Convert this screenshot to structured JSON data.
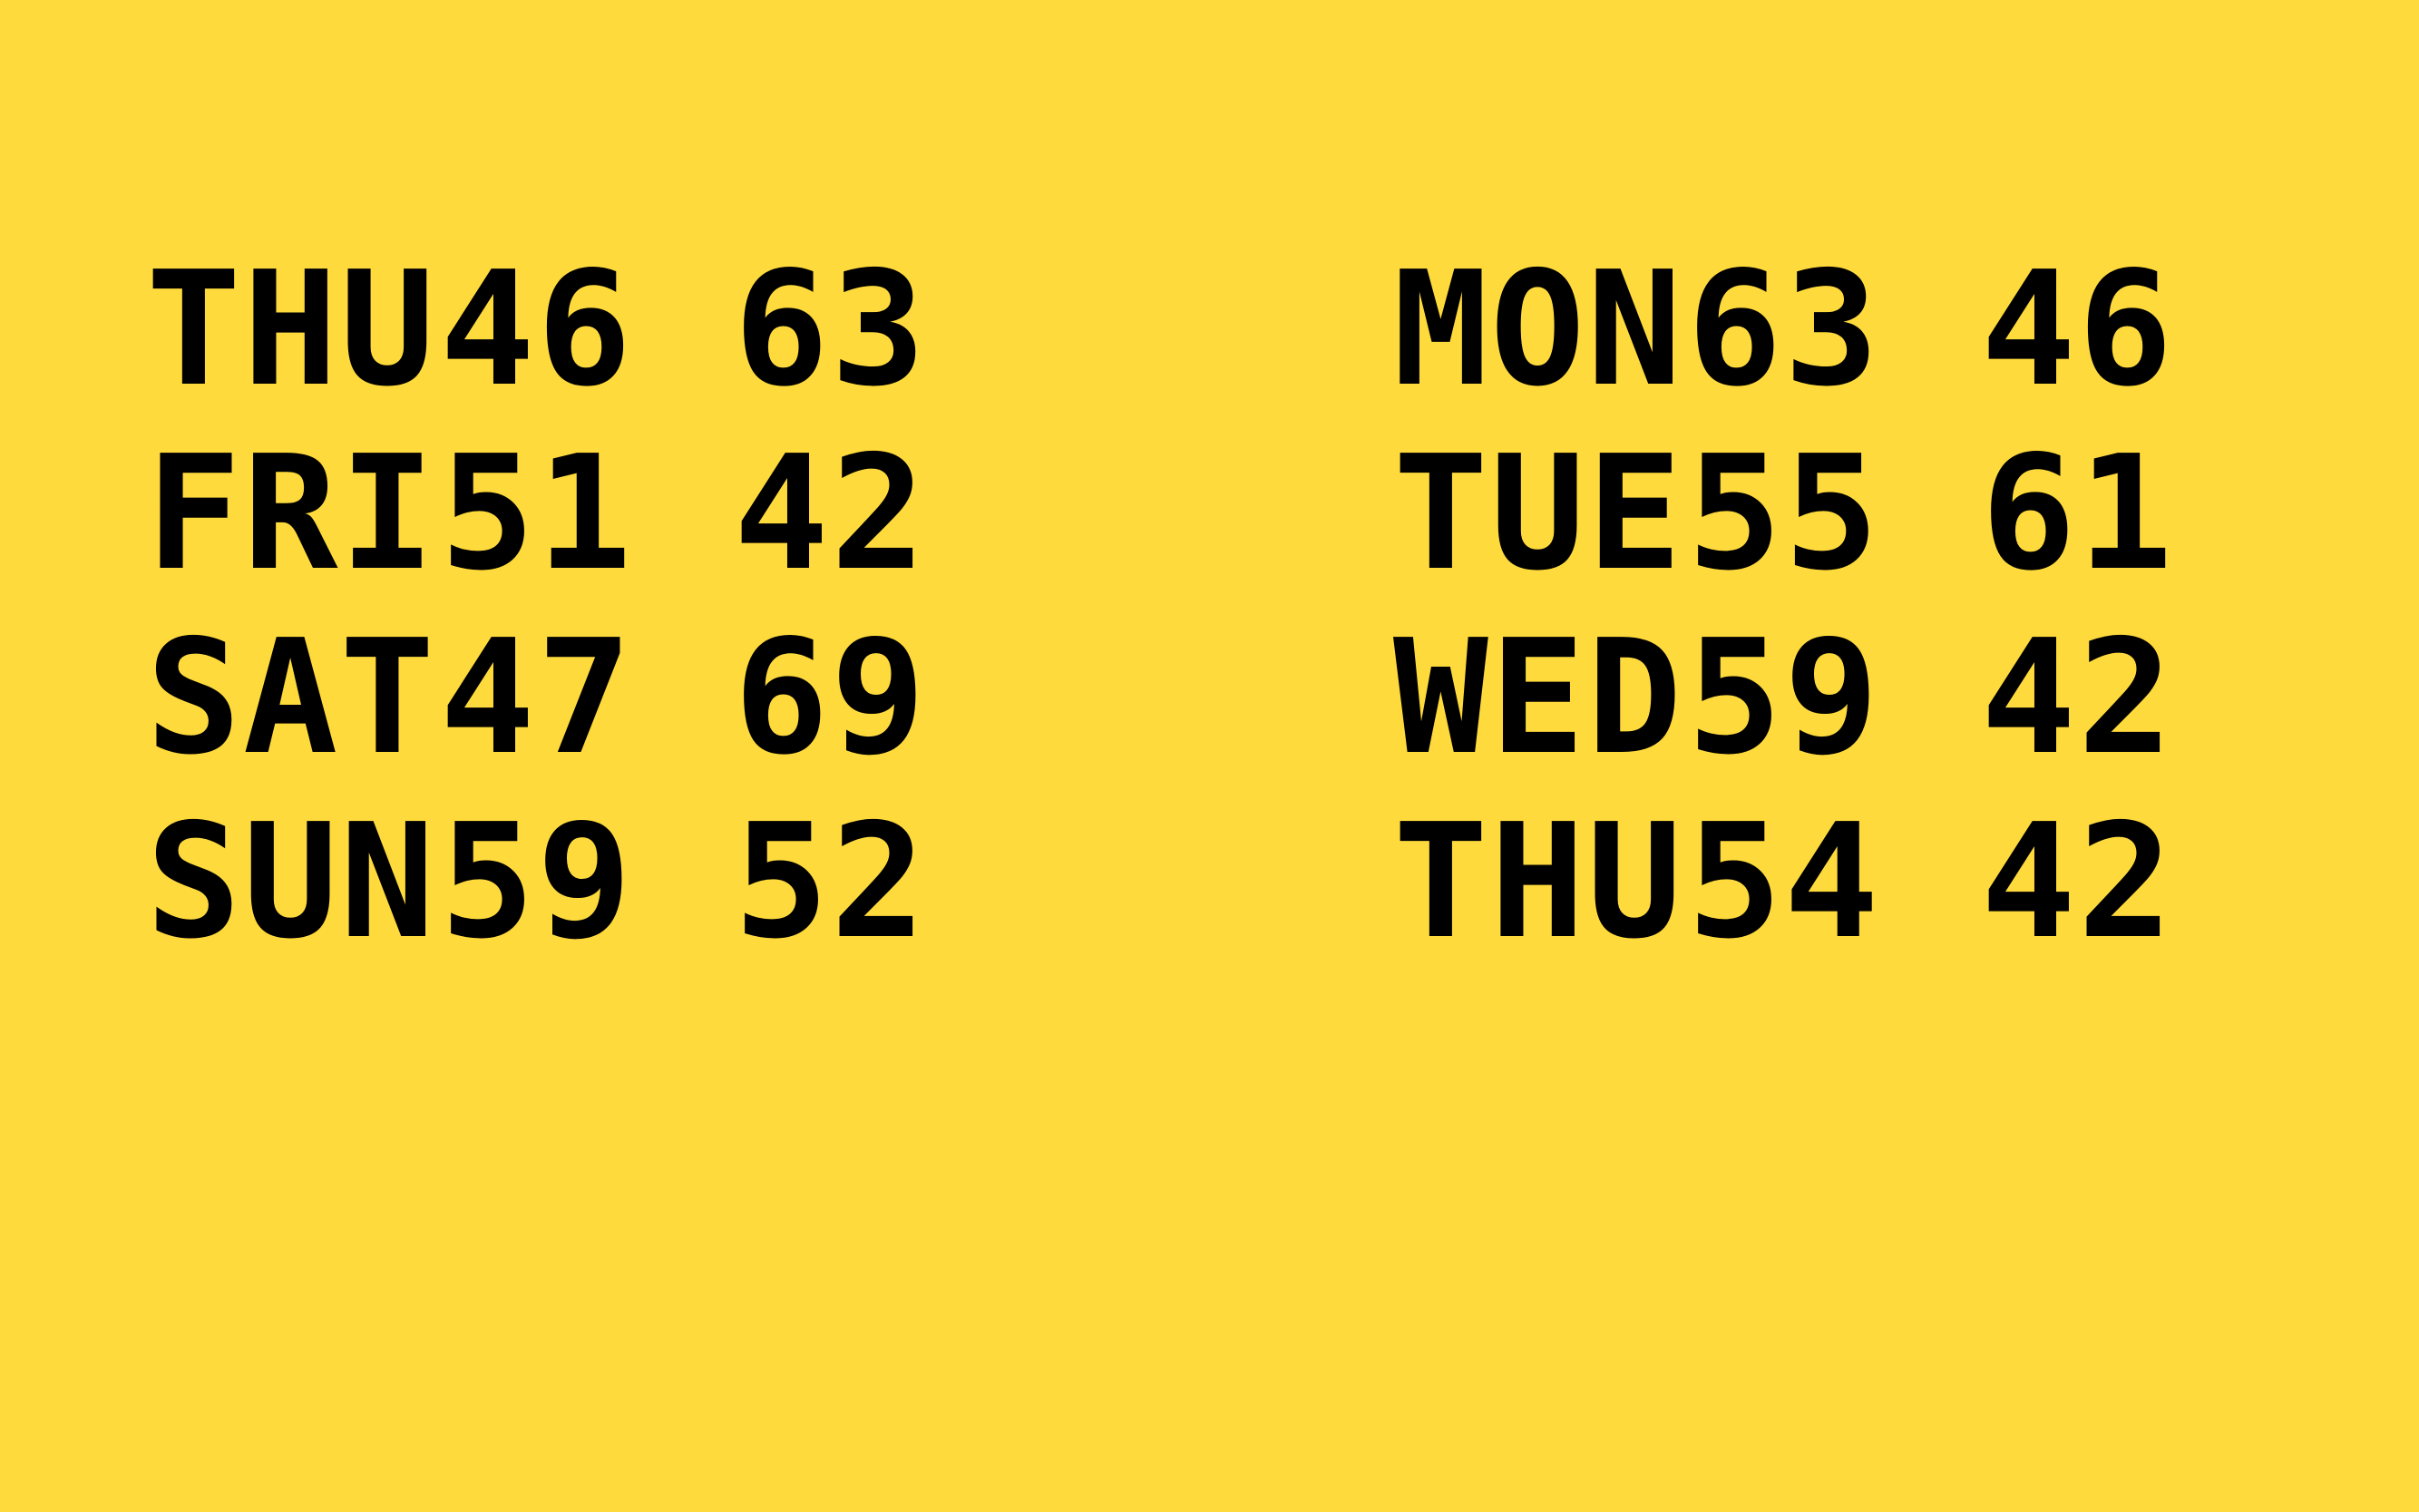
{
  "colors": {
    "background": "#FFDA3C",
    "text": "#000000"
  },
  "forecast": {
    "left": [
      {
        "day": "THU",
        "a": "46",
        "b": "63"
      },
      {
        "day": "FRI",
        "a": "51",
        "b": "42"
      },
      {
        "day": "SAT",
        "a": "47",
        "b": "69"
      },
      {
        "day": "SUN",
        "a": "59",
        "b": "52"
      }
    ],
    "right": [
      {
        "day": "MON",
        "a": "63",
        "b": "46"
      },
      {
        "day": "TUE",
        "a": "55",
        "b": "61"
      },
      {
        "day": "WED",
        "a": "59",
        "b": "42"
      },
      {
        "day": "THU",
        "a": "54",
        "b": "42"
      }
    ]
  }
}
